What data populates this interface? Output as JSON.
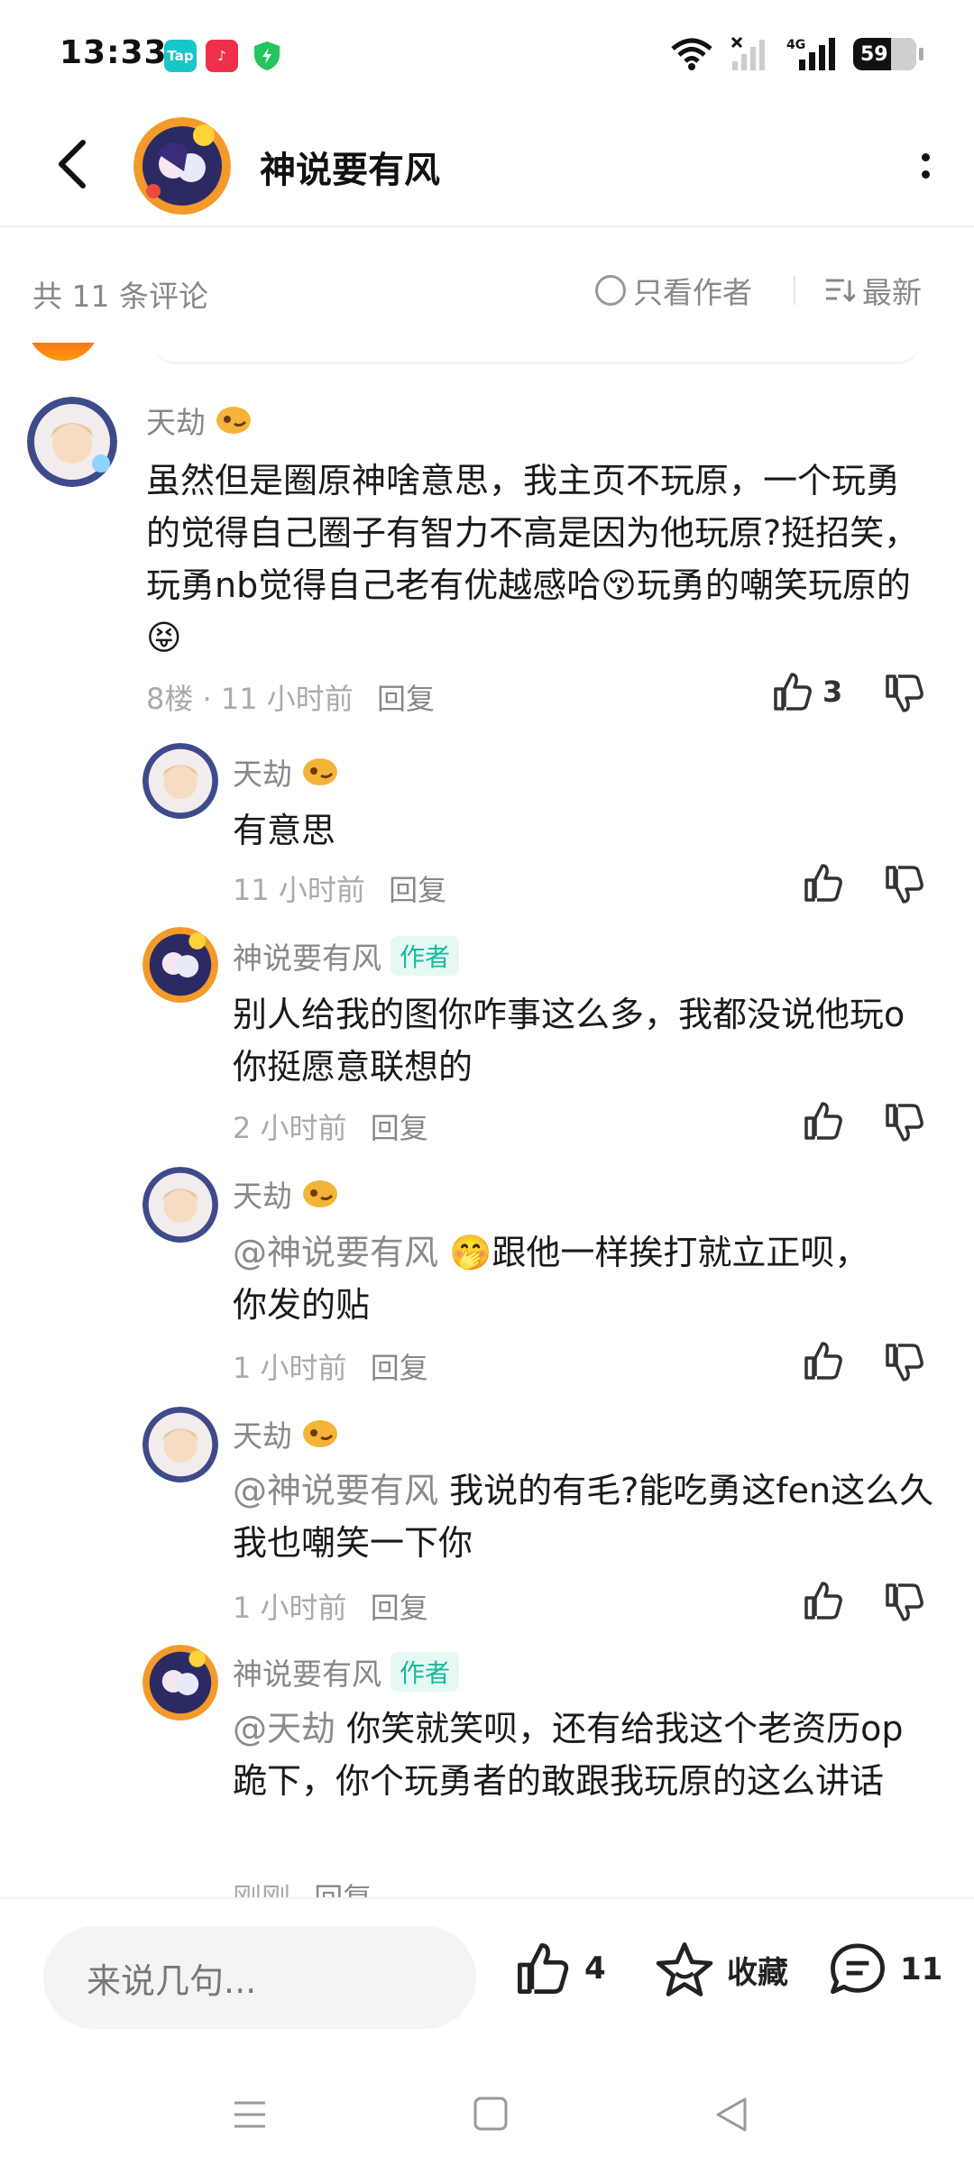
{
  "status_bar": {
    "time": "13:33",
    "app_icons": [
      "tap-icon",
      "music-icon",
      "shield-icon"
    ],
    "network": "4G",
    "battery": "59"
  },
  "header": {
    "title": "神说要有风"
  },
  "filter": {
    "count_text": "共 11 条评论",
    "author_only": "只看作者",
    "sort": "最新"
  },
  "comments": {
    "main": {
      "user": "天劫",
      "text": "虽然但是圈原神啥意思，我主页不玩原，一个玩勇的觉得自己圈子有智力不高是因为他玩原?挺招笑，玩勇nb觉得自己老有优越感哈😚玩勇的嘲笑玩原的😝",
      "floor": "8楼 · 11 小时前",
      "reply": "回复",
      "likes": "3"
    },
    "replies": [
      {
        "user": "天劫",
        "text": "有意思",
        "mention": "",
        "time": "11 小时前",
        "reply": "回复"
      },
      {
        "user": "神说要有风",
        "badge": "作者",
        "text": "别人给我的图你咋事这么多，我都没说他玩o你挺愿意联想的",
        "mention": "",
        "time": "2 小时前",
        "reply": "回复"
      },
      {
        "user": "天劫",
        "mention": "@神说要有风",
        "text": "🤭跟他一样挨打就立正呗，你发的贴",
        "time": "1 小时前",
        "reply": "回复"
      },
      {
        "user": "天劫",
        "mention": "@神说要有风",
        "text": "我说的有毛?能吃勇这fen这么久我也嘲笑一下你",
        "time": "1 小时前",
        "reply": "回复"
      },
      {
        "user": "神说要有风",
        "badge": "作者",
        "mention": "@天劫",
        "text": "你笑就笑呗，还有给我这个老资历op跪下，你个玩勇者的敢跟我玩原的这么讲话",
        "time": "刚刚",
        "reply": "回复"
      }
    ]
  },
  "bottom_bar": {
    "input_placeholder": "来说几句...",
    "likes": "4",
    "favorite_label": "收藏",
    "comments": "11"
  },
  "colors": {
    "accent_badge": "#1ab99a",
    "muted_text": "#888888"
  }
}
